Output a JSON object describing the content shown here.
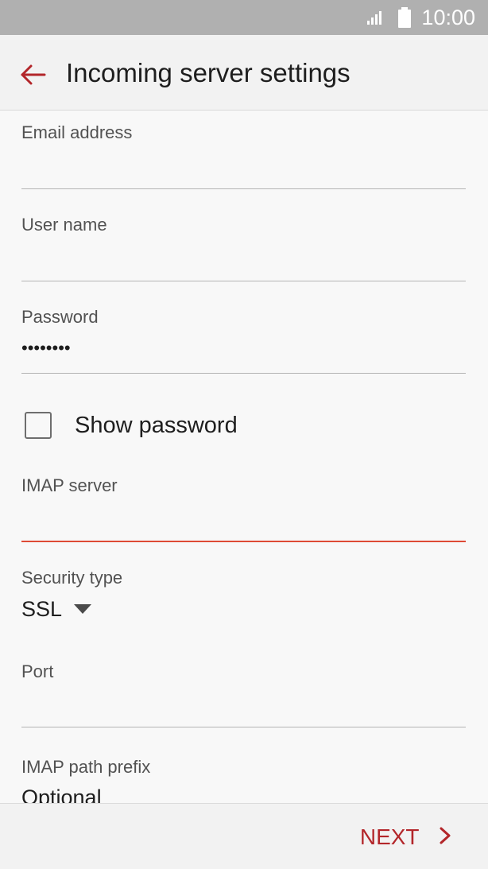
{
  "status_bar": {
    "time": "10:00",
    "icons": [
      "signal-icon",
      "battery-icon"
    ]
  },
  "app_bar": {
    "title": "Incoming server settings",
    "back_icon": "back-arrow-icon"
  },
  "form": {
    "email": {
      "label": "Email address",
      "value": ""
    },
    "username": {
      "label": "User name",
      "value": ""
    },
    "password": {
      "label": "Password",
      "value": "••••••••"
    },
    "show_password": {
      "label": "Show password",
      "checked": false
    },
    "imap_server": {
      "label": "IMAP server",
      "value": "",
      "focused": true
    },
    "security_type": {
      "label": "Security type",
      "value": "SSL"
    },
    "port": {
      "label": "Port",
      "value": ""
    },
    "imap_path_prefix": {
      "label": "IMAP path prefix",
      "placeholder": "Optional"
    }
  },
  "bottom_bar": {
    "next_label": "NEXT"
  },
  "colors": {
    "accent": "#b3262a",
    "focus_underline": "#de4a36",
    "status_bar": "#b0b0b0",
    "app_bar": "#f2f2f2",
    "background": "#f8f8f8"
  }
}
